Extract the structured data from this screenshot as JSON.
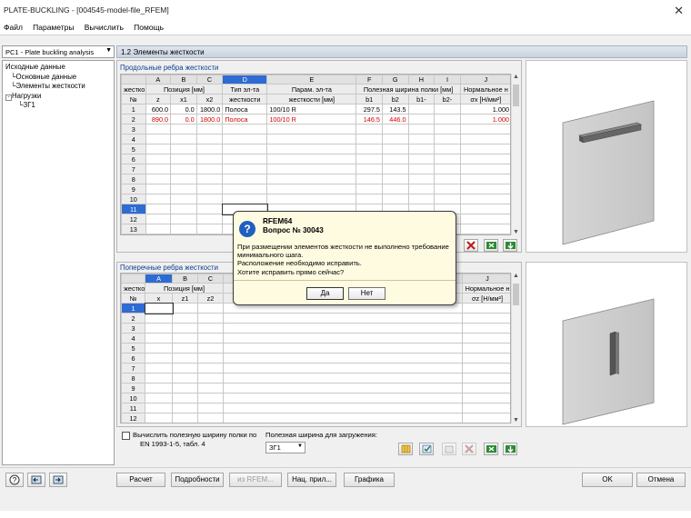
{
  "window": {
    "title": "PLATE-BUCKLING - [004545-model-file_RFEM]",
    "close_glyph": "✕"
  },
  "menu": [
    "Файл",
    "Параметры",
    "Вычислить",
    "Помощь"
  ],
  "case_select": {
    "value": "PC1 - Plate buckling analysis"
  },
  "section_header": "1.2 Элементы жесткости",
  "tree": {
    "root": "Исходные данные",
    "items": [
      "Основные данные",
      "Элементы жесткости"
    ],
    "loads_group": "Нагрузки",
    "loads_items": [
      "ЗГ1"
    ]
  },
  "longitudinal": {
    "title": "Продольные ребра жесткости",
    "col_letters": [
      "A",
      "B",
      "C",
      "D",
      "E",
      "F",
      "G",
      "H",
      "I",
      "J"
    ],
    "head1": [
      "жестко",
      "Позиция [мм]",
      "Тип эл-та",
      "Парам. эл-та",
      "Полезная ширина полки [мм]",
      "Нормальное н"
    ],
    "head2": [
      "№",
      "z",
      "x1",
      "x2",
      "жесткости",
      "жесткости [мм]",
      "b1",
      "b2",
      "b1-",
      "b2-",
      "σx [Н/мм²]"
    ],
    "rows": [
      {
        "n": "1",
        "z": "600.0",
        "x1": "0.0",
        "x2": "1800.0",
        "type": "Полоса",
        "param": "100/10 R",
        "b1": "297.5",
        "b2": "143.5",
        "b1m": "",
        "b2m": "",
        "sx": "1.000"
      },
      {
        "n": "2",
        "z": "890.0",
        "x1": "0.0",
        "x2": "1800.0",
        "type": "Полоса",
        "param": "100/10 R",
        "b1": "146.5",
        "b2": "446.0",
        "b1m": "",
        "b2m": "",
        "sx": "1.000"
      }
    ],
    "empty_rows": [
      "3",
      "4",
      "5",
      "6",
      "7",
      "8",
      "9",
      "10",
      "11",
      "12",
      "13"
    ]
  },
  "transverse": {
    "title": "Поперечные ребра жесткости",
    "col_letters": [
      "A",
      "B",
      "C",
      "J"
    ],
    "head1": [
      "жестко",
      "Позиция [мм]",
      "Нормальное н"
    ],
    "head2": [
      "№",
      "x",
      "z1",
      "z2",
      "σz [Н/мм²]"
    ],
    "rows": [
      "1",
      "2",
      "3",
      "4",
      "5",
      "6",
      "7",
      "8",
      "9",
      "10",
      "11",
      "12"
    ]
  },
  "options": {
    "checkbox_label": "Вычислить полезную ширину полки по EN 1993-1-5, табл. 4",
    "checkbox_line1": "Вычислить полезную ширину полки по",
    "checkbox_line2": "EN 1993-1-5, табл. 4",
    "load_label": "Полезная ширина для загружения:",
    "load_value": "ЗГ1"
  },
  "dialog": {
    "title": "RFEM64",
    "subtitle": "Вопрос № 30043",
    "icon": "?",
    "message_lines": [
      "При размещении элементов жесткости не выполнено требование",
      "минимального шага.",
      "Расположение необходимо исправить.",
      "Хотите исправить прямо сейчас?"
    ],
    "yes": "Да",
    "no": "Нет"
  },
  "bottom": {
    "calc": "Расчет",
    "details": "Подробности",
    "from_rfem": "из RFEM...",
    "national": "Нац. прил...",
    "graphics": "Графика",
    "ok": "OK",
    "cancel": "Отмена"
  },
  "colors": {
    "selection": "#2e6bd2",
    "red_row": "#d40000",
    "dialog_bg": "#fffbe1",
    "header_blue": "#0b3d91"
  }
}
